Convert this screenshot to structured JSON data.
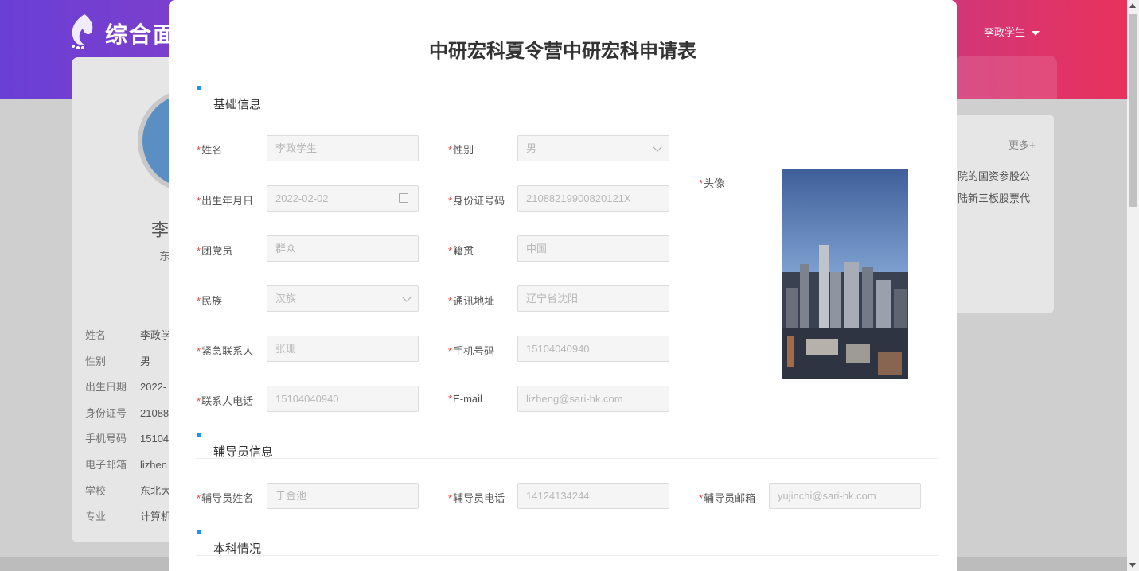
{
  "background": {
    "app_title": "综合面",
    "user_menu": "李政学生",
    "profile_name": "李",
    "profile_sub": "东",
    "info": [
      {
        "key": "姓名",
        "value": "李政学"
      },
      {
        "key": "性别",
        "value": "男"
      },
      {
        "key": "出生日期",
        "value": "2022-"
      },
      {
        "key": "身份证号",
        "value": "21088"
      },
      {
        "key": "手机号码",
        "value": "15104"
      },
      {
        "key": "电子邮箱",
        "value": "lizhen"
      },
      {
        "key": "学校",
        "value": "东北大"
      },
      {
        "key": "专业",
        "value": "计算机"
      }
    ],
    "more_link": "更多+",
    "news": [
      "院的国资参股公",
      "陆新三板股票代"
    ]
  },
  "modal": {
    "title": "中研宏科夏令营中研宏科申请表",
    "sections": {
      "basic": "基础信息",
      "counselor": "辅导员信息",
      "undergrad": "本科情况"
    },
    "required_mark": "*",
    "fields": {
      "name": {
        "label": "姓名",
        "value": "李政学生"
      },
      "gender": {
        "label": "性别",
        "value": "男"
      },
      "birth": {
        "label": "出生年月日",
        "value": "2022-02-02"
      },
      "id_number": {
        "label": "身份证号码",
        "value": "21088219900820121X"
      },
      "political": {
        "label": "团党员",
        "value": "群众"
      },
      "native": {
        "label": "籍贯",
        "value": "中国"
      },
      "ethnicity": {
        "label": "民族",
        "value": "汉族"
      },
      "address": {
        "label": "通讯地址",
        "value": "辽宁省沈阳"
      },
      "emergency_contact": {
        "label": "紧急联系人",
        "value": "张珊"
      },
      "phone": {
        "label": "手机号码",
        "value": "15104040940"
      },
      "contact_phone": {
        "label": "联系人电话",
        "value": "15104040940"
      },
      "email": {
        "label": "E-mail",
        "value": "lizheng@sari-hk.com"
      },
      "avatar": {
        "label": "头像"
      },
      "counselor_name": {
        "label": "辅导员姓名",
        "value": "于金池"
      },
      "counselor_phone": {
        "label": "辅导员电话",
        "value": "14124134244"
      },
      "counselor_email": {
        "label": "辅导员邮箱",
        "value": "yujinchi@sari-hk.com"
      }
    }
  }
}
